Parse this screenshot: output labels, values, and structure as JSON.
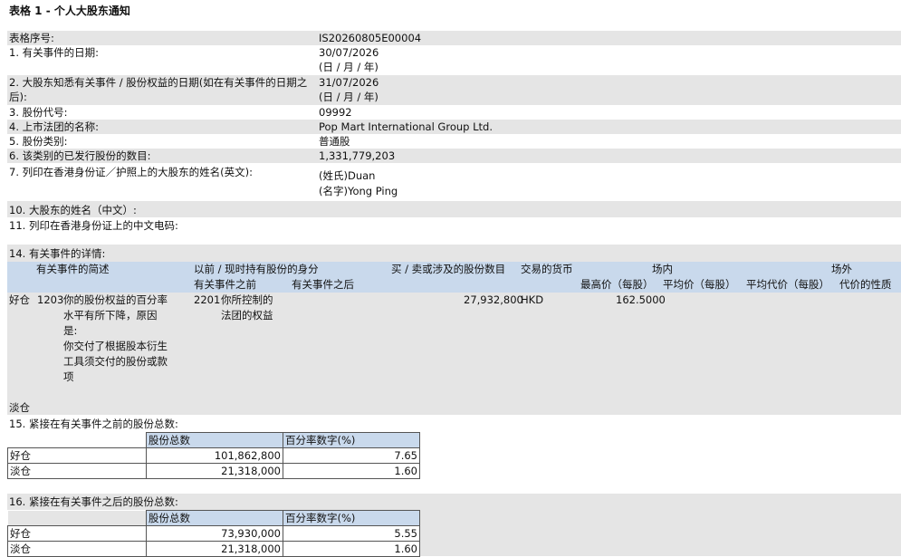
{
  "title": "表格 1 - 个人大股东通知",
  "fields": [
    {
      "label": "表格序号:",
      "value": "IS20260805E00004"
    },
    {
      "label": "1. 有关事件的日期:",
      "value": "30/07/2026",
      "note": "(日 / 月 / 年)"
    },
    {
      "label": "2. 大股东知悉有关事件 / 股份权益的日期(如在有关事件的日期之",
      "label2": "后):",
      "value": "31/07/2026",
      "note": "(日 / 月 / 年)"
    },
    {
      "label": "3. 股份代号:",
      "value": "09992"
    },
    {
      "label": "4. 上市法团的名称:",
      "value": "Pop Mart International Group Ltd."
    },
    {
      "label": "5. 股份类别:",
      "value": "普通股"
    },
    {
      "label": "6. 该类别的已发行股份的数目:",
      "value": "1,331,779,203"
    },
    {
      "label": "7. 列印在香港身份证／护照上的大股东的姓名(英文):",
      "value": "(姓氏)Duan",
      "value2": "(名字)Yong Ping"
    },
    {
      "label": "10. 大股东的姓名（中文）:"
    },
    {
      "label": "11. 列印在香港身份证上的中文电码:"
    }
  ],
  "section14": {
    "title": "14. 有关事件的详情:",
    "headers": {
      "event_desc": "有关事件的简述",
      "capacity": "以前 / 现时持有股份的身分",
      "before": "有关事件之前",
      "after": "有关事件之后",
      "shares": "买 / 卖或涉及的股份数目",
      "currency": "交易的货币",
      "onex": "场内",
      "high": "最高价（每股）",
      "avg": "平均价（每股）",
      "offex": "场外",
      "avg_cons": "平均代价（每股）",
      "cons_nature": "代价的性质"
    },
    "long_label": "好仓",
    "code": "1203",
    "desc_lines": [
      "你的股份权益的百分率",
      "水平有所下降，原因",
      "是:",
      "你交付了根据股本衍生",
      "工具须交付的股份或款",
      "项"
    ],
    "cap_code": "2201",
    "cap_lines": [
      "你所控制的",
      "法团的权益"
    ],
    "shares": "27,932,800",
    "currency": "HKD",
    "high": "162.5000",
    "short_label": "淡仓"
  },
  "section15": {
    "title": "15. 紧接在有关事件之前的股份总数:",
    "col1": "股份总数",
    "col2": "百分率数字(%)",
    "rows": [
      {
        "label": "好仓",
        "shares": "101,862,800",
        "pct": "7.65"
      },
      {
        "label": "淡仓",
        "shares": "21,318,000",
        "pct": "1.60"
      }
    ]
  },
  "section16": {
    "title": "16. 紧接在有关事件之后的股份总数:",
    "col1": "股份总数",
    "col2": "百分率数字(%)",
    "rows": [
      {
        "label": "好仓",
        "shares": "73,930,000",
        "pct": "5.55"
      },
      {
        "label": "淡仓",
        "shares": "21,318,000",
        "pct": "1.60"
      }
    ]
  }
}
